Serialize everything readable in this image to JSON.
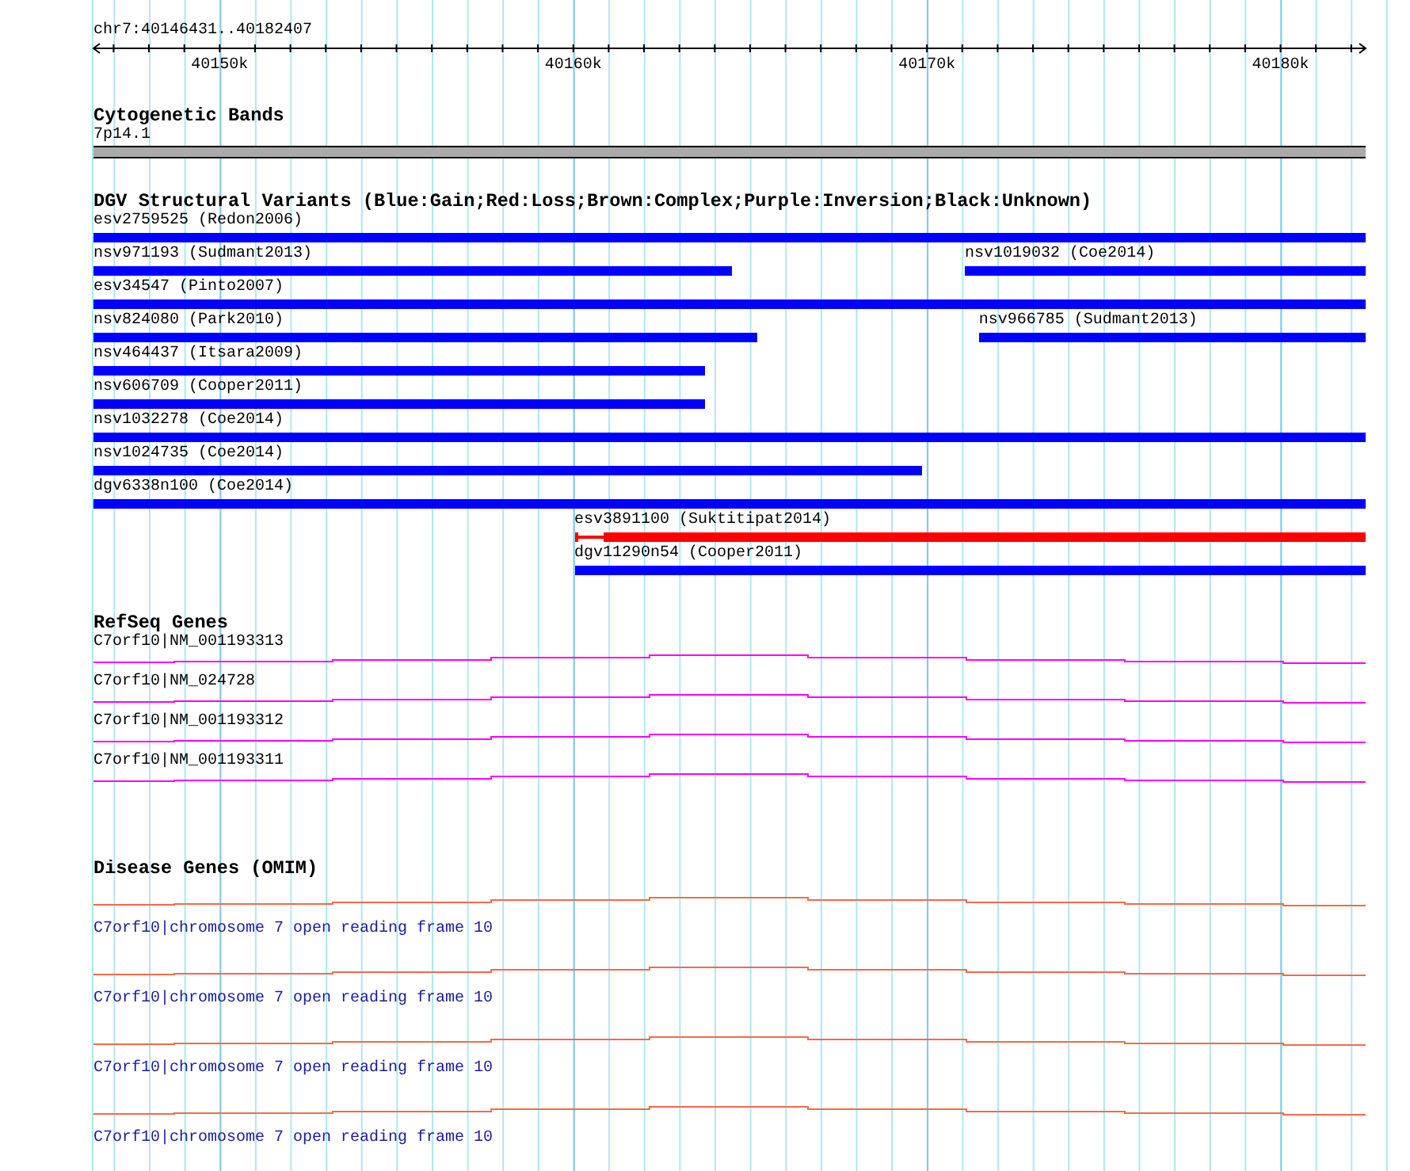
{
  "ruler": {
    "region": "chr7:40146431..40182407",
    "ticks": [
      "40150k",
      "40160k",
      "40170k",
      "40180k"
    ]
  },
  "tracks": [
    {
      "kind": "bands",
      "title": "Cytogenetic Bands",
      "bands": [
        {
          "label": "7p14.1"
        }
      ]
    },
    {
      "kind": "variants",
      "title": "DGV Structural Variants (Blue:Gain;Red:Loss;Brown:Complex;Purple:Inversion;Black:Unknown)",
      "rows": [
        {
          "features": [
            {
              "label": "esv2759525 (Redon2006)",
              "color": "#0000ff"
            }
          ]
        },
        {
          "features": [
            {
              "label": "nsv971193 (Sudmant2013)",
              "color": "#0000ff"
            },
            {
              "label": "nsv1019032 (Coe2014)",
              "color": "#0000ff"
            }
          ]
        },
        {
          "features": [
            {
              "label": "esv34547 (Pinto2007)",
              "color": "#0000ff"
            }
          ]
        },
        {
          "features": [
            {
              "label": "nsv824080 (Park2010)",
              "color": "#0000ff"
            },
            {
              "label": "nsv966785 (Sudmant2013)",
              "color": "#0000ff"
            }
          ]
        },
        {
          "features": [
            {
              "label": "nsv464437 (Itsara2009)",
              "color": "#0000ff"
            }
          ]
        },
        {
          "features": [
            {
              "label": "nsv606709 (Cooper2011)",
              "color": "#0000ff"
            }
          ]
        },
        {
          "features": [
            {
              "label": "nsv1032278 (Coe2014)",
              "color": "#0000ff"
            }
          ]
        },
        {
          "features": [
            {
              "label": "nsv1024735 (Coe2014)",
              "color": "#0000ff"
            }
          ]
        },
        {
          "features": [
            {
              "label": "dgv6338n100 (Coe2014)",
              "color": "#0000ff"
            }
          ]
        },
        {
          "features": [
            {
              "label": "esv3891100 (Suktitipat2014)",
              "color": "#ff0000"
            }
          ]
        },
        {
          "features": [
            {
              "label": "dgv11290n54 (Cooper2011)",
              "color": "#0000ff"
            }
          ]
        }
      ]
    },
    {
      "kind": "genes",
      "title": "RefSeq Genes",
      "genes": [
        {
          "label": "C7orf10|NM_001193313"
        },
        {
          "label": "C7orf10|NM_024728"
        },
        {
          "label": "C7orf10|NM_001193312"
        },
        {
          "label": "C7orf10|NM_001193311"
        }
      ]
    },
    {
      "kind": "disease",
      "title": "Disease Genes (OMIM)",
      "genes": [
        {
          "label": "C7orf10|chromosome 7 open reading frame 10"
        },
        {
          "label": "C7orf10|chromosome 7 open reading frame 10"
        },
        {
          "label": "C7orf10|chromosome 7 open reading frame 10"
        },
        {
          "label": "C7orf10|chromosome 7 open reading frame 10"
        }
      ]
    }
  ]
}
